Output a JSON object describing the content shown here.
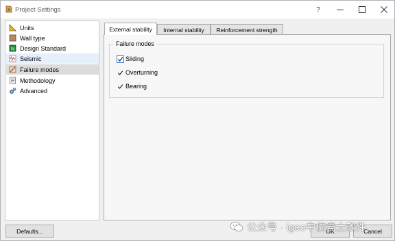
{
  "window": {
    "title": "Project Settings",
    "help_label": "?"
  },
  "nav": {
    "items": [
      {
        "label": "Units",
        "icon": "ruler-triangle-icon"
      },
      {
        "label": "Wall type",
        "icon": "wall-icon"
      },
      {
        "label": "Design Standard",
        "icon": "standard-book-icon"
      },
      {
        "label": "Seismic",
        "icon": "seismic-icon"
      },
      {
        "label": "Failure modes",
        "icon": "failure-mode-icon"
      },
      {
        "label": "Methodology",
        "icon": "methodology-icon"
      },
      {
        "label": "Advanced",
        "icon": "gears-icon"
      }
    ],
    "selected": "Failure modes",
    "hovered": "Seismic"
  },
  "tabs": [
    {
      "label": "External stability",
      "active": true
    },
    {
      "label": "Internal stability",
      "active": false
    },
    {
      "label": "Reinforcement strength",
      "active": false
    }
  ],
  "group": {
    "title": "Failure modes",
    "options": [
      {
        "label": "Sliding",
        "checked": true
      },
      {
        "label": "Overturning",
        "checked": true
      },
      {
        "label": "Bearing",
        "checked": true
      }
    ]
  },
  "buttons": {
    "defaults": "Defaults...",
    "ok": "OK",
    "cancel": "Cancel"
  },
  "watermark": {
    "text": "公众号 · igeo中仿岩土软件"
  },
  "colors": {
    "selected_item": "#dcdcdc",
    "hover_item": "#e5f0fb",
    "check_mark": "#1a1a1a",
    "focus_border": "#2b7bd3"
  }
}
